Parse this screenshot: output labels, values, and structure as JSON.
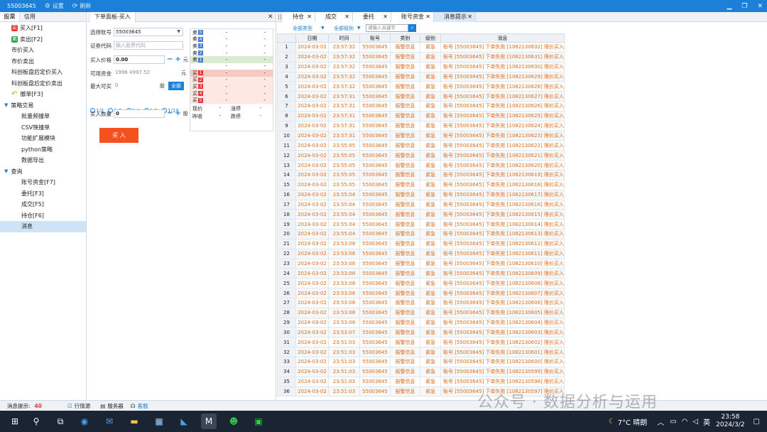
{
  "titlebar": {
    "account": "55003645",
    "settings": "设置",
    "refresh": "刷新"
  },
  "nav": {
    "tabs": [
      "股票",
      "信用"
    ],
    "items": [
      {
        "label": "买入[F1]",
        "badge": "买",
        "badge_color": "#e53935",
        "indent": 1
      },
      {
        "label": "卖出[F2]",
        "badge": "卖",
        "badge_color": "#2e9e4f",
        "indent": 1
      },
      {
        "label": "市价买入",
        "indent": 0
      },
      {
        "label": "市价卖出",
        "indent": 0
      },
      {
        "label": "科创板盘后定价买入",
        "indent": 0
      },
      {
        "label": "科创板盘后定价卖出",
        "indent": 0
      },
      {
        "label": "撤单[F3]",
        "icon": "undo-icon",
        "indent": 1
      },
      {
        "label": "策略交易",
        "caret": true,
        "indent": 0
      },
      {
        "label": "批量频撞单",
        "indent": 2
      },
      {
        "label": "CSV筷撞单",
        "indent": 2
      },
      {
        "label": "功能扩展模块",
        "indent": 2
      },
      {
        "label": "python策略",
        "indent": 2
      },
      {
        "label": "数据导出",
        "indent": 2
      },
      {
        "label": "查询",
        "caret": true,
        "indent": 0
      },
      {
        "label": "账号资金[F7]",
        "indent": 2
      },
      {
        "label": "委托[F3]",
        "indent": 2
      },
      {
        "label": "成交[F5]",
        "indent": 2
      },
      {
        "label": "持仓[F6]",
        "indent": 2
      },
      {
        "label": "消息",
        "indent": 2,
        "selected": true
      }
    ]
  },
  "order": {
    "tab": "下单面板-买入",
    "account_label": "选择账号",
    "account_value": "55003645",
    "code_label": "证券代码",
    "code_placeholder": "输入股票代码",
    "price_label": "买入价格",
    "price_value": "0.00",
    "price_unit": "元",
    "funds_label": "可用资金",
    "funds_value": "1996 4997.52",
    "funds_unit": "元",
    "max_label": "最大可买",
    "max_value": "0",
    "max_unit": "股",
    "all_btn": "全部",
    "ratios": [
      "1/2",
      "1/3",
      "1/4",
      "1/5",
      "1/10"
    ],
    "qty_label": "买入数量",
    "qty_value": "0",
    "qty_unit": "股",
    "buy_btn": "买 入"
  },
  "book": {
    "sell": [
      {
        "label": "卖",
        "n": "5",
        "price": "-",
        "vol": "-"
      },
      {
        "label": "卖",
        "n": "4",
        "price": "-",
        "vol": "-"
      },
      {
        "label": "卖",
        "n": "3",
        "price": "-",
        "vol": "-"
      },
      {
        "label": "卖",
        "n": "2",
        "price": "-",
        "vol": "-"
      },
      {
        "label": "卖",
        "n": "1",
        "price": "-",
        "vol": "-"
      }
    ],
    "mid": {
      "price": "-",
      "vol": "-"
    },
    "buy": [
      {
        "label": "买",
        "n": "1",
        "price": "-",
        "vol": "-"
      },
      {
        "label": "买",
        "n": "2",
        "price": "-",
        "vol": "-"
      },
      {
        "label": "买",
        "n": "3",
        "price": "-",
        "vol": "-"
      },
      {
        "label": "买",
        "n": "4",
        "price": "-",
        "vol": "-"
      },
      {
        "label": "买",
        "n": "5",
        "price": "-",
        "vol": "-"
      }
    ],
    "foot": [
      {
        "l1": "现价",
        "v1": "-",
        "l2": "涨停",
        "v2": "-"
      },
      {
        "l1": "昨收",
        "v1": "-",
        "l2": "跌停",
        "v2": "-"
      }
    ]
  },
  "right": {
    "tabs": [
      "持仓",
      "成交",
      "委托",
      "账号资金",
      "消息提示"
    ],
    "filter_type": "全部类型",
    "filter_level": "全部级别",
    "search_placeholder": "请输入关键字",
    "columns": [
      "日期",
      "时间",
      "账号",
      "类别",
      "级别",
      "消息"
    ],
    "rows": [
      {
        "time": "23:57:32",
        "id": "1082130632"
      },
      {
        "time": "23:57:32",
        "id": "1082130631"
      },
      {
        "time": "23:57:32",
        "id": "1082130630"
      },
      {
        "time": "23:57:32",
        "id": "1082130629"
      },
      {
        "time": "23:57:32",
        "id": "1082130628"
      },
      {
        "time": "23:57:31",
        "id": "1082130627"
      },
      {
        "time": "23:57:31",
        "id": "1082130626"
      },
      {
        "time": "23:57:31",
        "id": "1082130625"
      },
      {
        "time": "23:57:31",
        "id": "1082130624"
      },
      {
        "time": "23:57:31",
        "id": "1082130623"
      },
      {
        "time": "23:55:05",
        "id": "1082130622"
      },
      {
        "time": "23:55:05",
        "id": "1082130621"
      },
      {
        "time": "23:55:05",
        "id": "1082130620"
      },
      {
        "time": "23:55:05",
        "id": "1082130619"
      },
      {
        "time": "23:55:05",
        "id": "1082130618"
      },
      {
        "time": "23:55:04",
        "id": "1082130617"
      },
      {
        "time": "23:55:04",
        "id": "1082130616"
      },
      {
        "time": "23:55:04",
        "id": "1082130615"
      },
      {
        "time": "23:55:04",
        "id": "1082130614"
      },
      {
        "time": "23:55:04",
        "id": "1082130613"
      },
      {
        "time": "23:53:08",
        "id": "1082130612"
      },
      {
        "time": "23:53:08",
        "id": "1082130611"
      },
      {
        "time": "23:53:08",
        "id": "1082130610"
      },
      {
        "time": "23:53:08",
        "id": "1082130609"
      },
      {
        "time": "23:53:08",
        "id": "1082130608"
      },
      {
        "time": "23:53:08",
        "id": "1082130607"
      },
      {
        "time": "23:53:08",
        "id": "1082130606"
      },
      {
        "time": "23:53:08",
        "id": "1082130605"
      },
      {
        "time": "23:53:08",
        "id": "1082130604"
      },
      {
        "time": "23:53:07",
        "id": "1082130603"
      },
      {
        "time": "23:51:03",
        "id": "1082130602"
      },
      {
        "time": "23:51:03",
        "id": "1082130601"
      },
      {
        "time": "23:51:03",
        "id": "1082130600"
      },
      {
        "time": "23:51:03",
        "id": "1082130599"
      },
      {
        "time": "23:51:03",
        "id": "1082130598"
      },
      {
        "time": "23:51:03",
        "id": "1082130597"
      }
    ],
    "row_date": "2024-03-02",
    "row_account": "55003645",
    "row_category": "报警信息",
    "row_level": "紧急",
    "msg_prefix": "账号 [55003645] 下单失败 [",
    "msg_suffix": "] 限价买入"
  },
  "status": {
    "label": "消息提示:",
    "count": "40",
    "source": "行情源",
    "server": "服务器",
    "service": "客服"
  },
  "taskbar": {
    "weather": "7°C 晴朗",
    "lang": "英",
    "time": "23:58",
    "date": "2024/3/2"
  },
  "watermark": "公众号 · 数据分析与运用",
  "colors": {
    "accent": "#1c7fd8",
    "buy": "#f4511e",
    "alert_text": "#e06b1a"
  }
}
